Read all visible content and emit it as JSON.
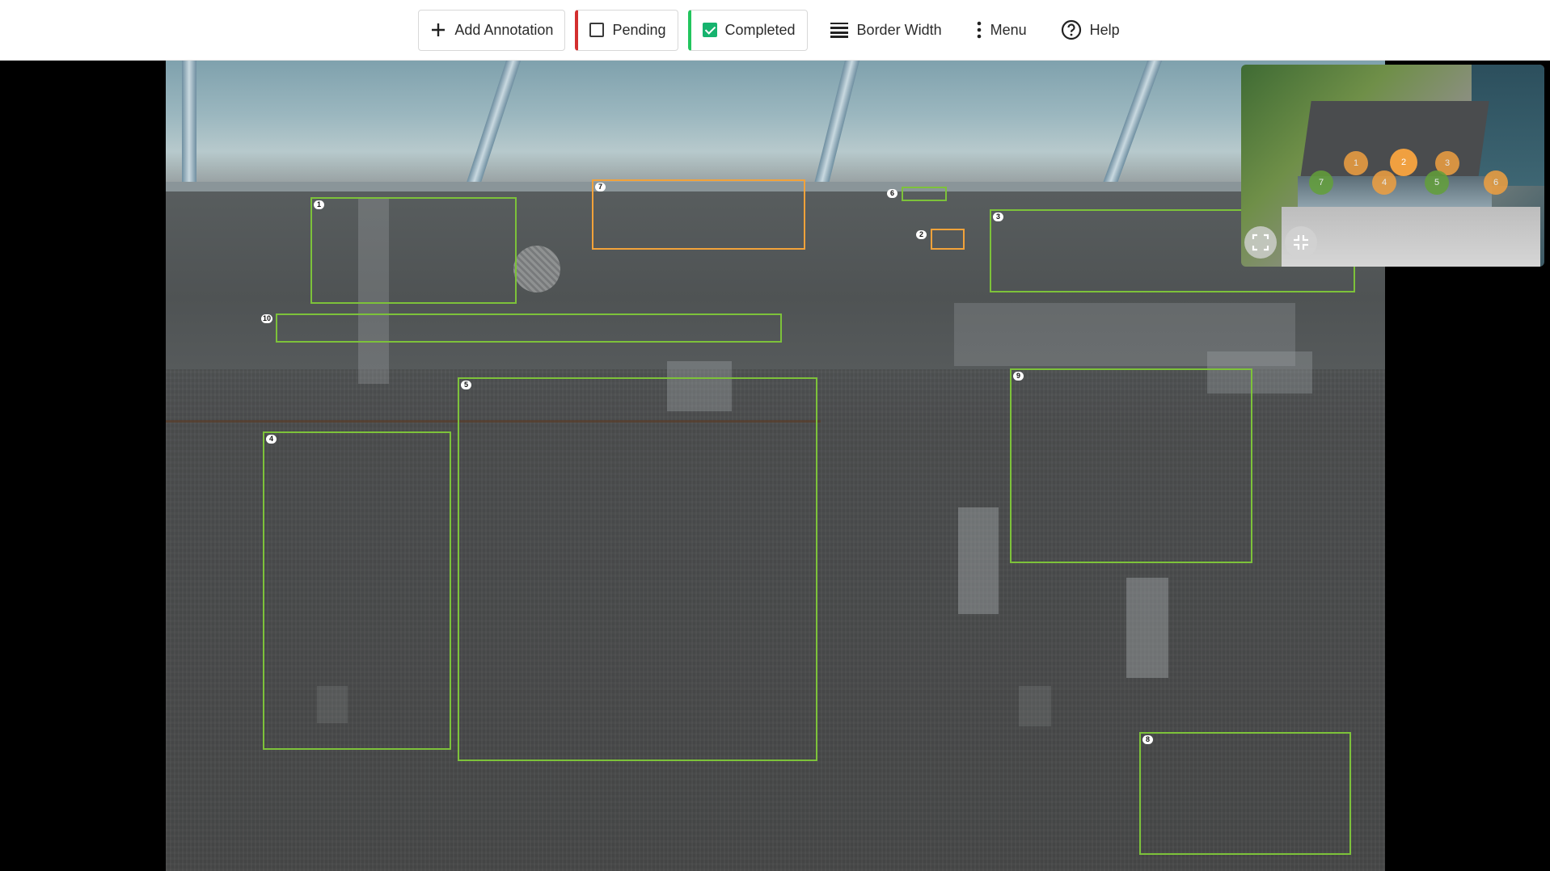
{
  "toolbar": {
    "add_annotation": "Add Annotation",
    "pending": "Pending",
    "completed": "Completed",
    "border_width": "Border Width",
    "menu": "Menu",
    "help": "Help",
    "pending_checked": false,
    "completed_checked": true
  },
  "colors": {
    "completed_border": "#7dc23a",
    "pending_border": "#f2a23a",
    "pending_accent": "#d32f2f",
    "completed_accent": "#22c55e"
  },
  "annotations": [
    {
      "label": "1",
      "status": "completed"
    },
    {
      "label": "7",
      "status": "pending"
    },
    {
      "label": "6",
      "status": "completed"
    },
    {
      "label": "2",
      "status": "pending"
    },
    {
      "label": "3",
      "status": "completed"
    },
    {
      "label": "10",
      "status": "completed"
    },
    {
      "label": "5",
      "status": "completed"
    },
    {
      "label": "9",
      "status": "completed"
    },
    {
      "label": "4",
      "status": "completed"
    },
    {
      "label": "8",
      "status": "completed"
    }
  ],
  "minimap": {
    "markers": [
      {
        "label": "1",
        "status": "pending"
      },
      {
        "label": "2",
        "status": "pending"
      },
      {
        "label": "3",
        "status": "pending"
      },
      {
        "label": "7",
        "status": "completed"
      },
      {
        "label": "4",
        "status": "pending"
      },
      {
        "label": "5",
        "status": "completed"
      },
      {
        "label": "6",
        "status": "pending"
      }
    ],
    "controls": [
      "fullscreen-icon",
      "collapse-icon"
    ]
  }
}
